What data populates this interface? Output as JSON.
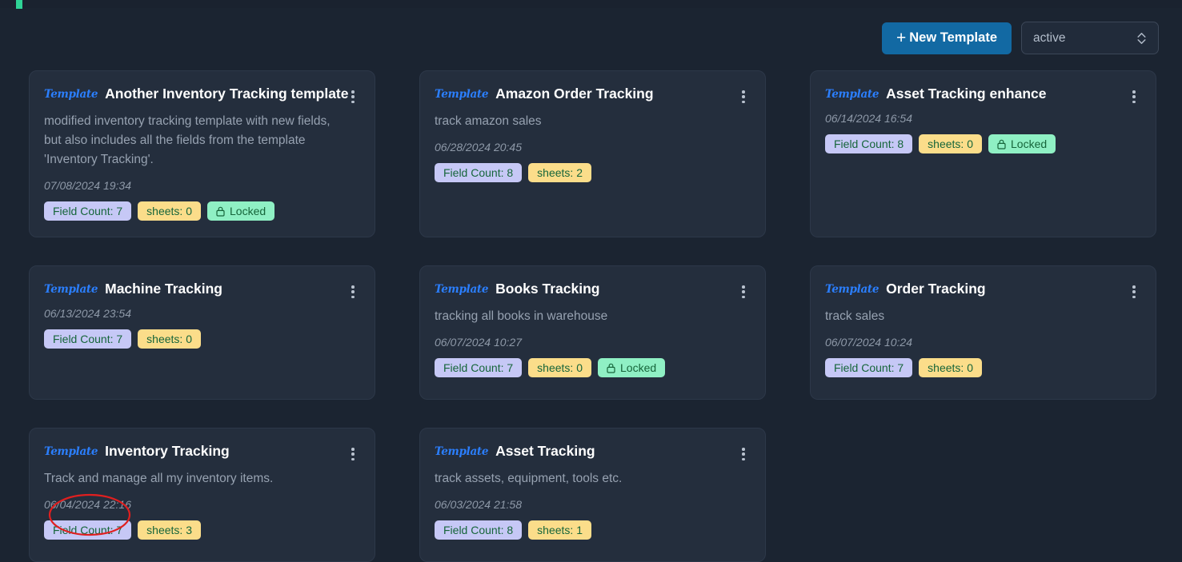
{
  "toolbar": {
    "new_template_label": "New Template",
    "plus_glyph": "+",
    "status_filter_value": "active",
    "status_filter_options": [
      "active"
    ]
  },
  "brand": {
    "wordmark": "Template"
  },
  "colors": {
    "page_background": "#1b2431",
    "card_background": "#242e3d",
    "primary_button": "#1269a3",
    "brand_blue": "#2b7fff",
    "badge_fields_bg": "#c6c8f6",
    "badge_sheets_bg": "#fbdd8a",
    "badge_locked_bg": "#8ff0c4",
    "badge_text": "#16653a",
    "annotation_red": "#e01f1f",
    "nav_indicator_green": "#2fd396"
  },
  "cards": [
    {
      "title": "Another Inventory Tracking template",
      "description": "modified inventory tracking template with new fields, but also includes all the fields from the template 'Inventory Tracking'.",
      "date": "07/08/2024 19:34",
      "field_count": "Field Count: 7",
      "sheets": "sheets: 0",
      "locked": "Locked",
      "is_locked": true
    },
    {
      "title": "Amazon Order Tracking",
      "description": "track amazon sales",
      "date": "06/28/2024 20:45",
      "field_count": "Field Count: 8",
      "sheets": "sheets: 2",
      "locked": "",
      "is_locked": false
    },
    {
      "title": "Asset Tracking enhance",
      "description": "",
      "date": "06/14/2024 16:54",
      "field_count": "Field Count: 8",
      "sheets": "sheets: 0",
      "locked": "Locked",
      "is_locked": true
    },
    {
      "title": "Machine Tracking",
      "description": "",
      "date": "06/13/2024 23:54",
      "field_count": "Field Count: 7",
      "sheets": "sheets: 0",
      "locked": "",
      "is_locked": false
    },
    {
      "title": "Books Tracking",
      "description": "tracking all books in warehouse",
      "date": "06/07/2024 10:27",
      "field_count": "Field Count: 7",
      "sheets": "sheets: 0",
      "locked": "Locked",
      "is_locked": true
    },
    {
      "title": "Order Tracking",
      "description": "track sales",
      "date": "06/07/2024 10:24",
      "field_count": "Field Count: 7",
      "sheets": "sheets: 0",
      "locked": "",
      "is_locked": false
    },
    {
      "title": "Inventory Tracking",
      "description": "Track and manage all my inventory items.",
      "date": "06/04/2024 22:16",
      "field_count": "Field Count: 7",
      "sheets": "sheets: 3",
      "locked": "",
      "is_locked": false
    },
    {
      "title": "Asset Tracking",
      "description": "track assets, equipment, tools etc.",
      "date": "06/03/2024 21:58",
      "field_count": "Field Count: 8",
      "sheets": "sheets: 1",
      "locked": "",
      "is_locked": false
    }
  ],
  "annotation": {
    "target": "Field Count: 7",
    "shape": "ellipse"
  }
}
